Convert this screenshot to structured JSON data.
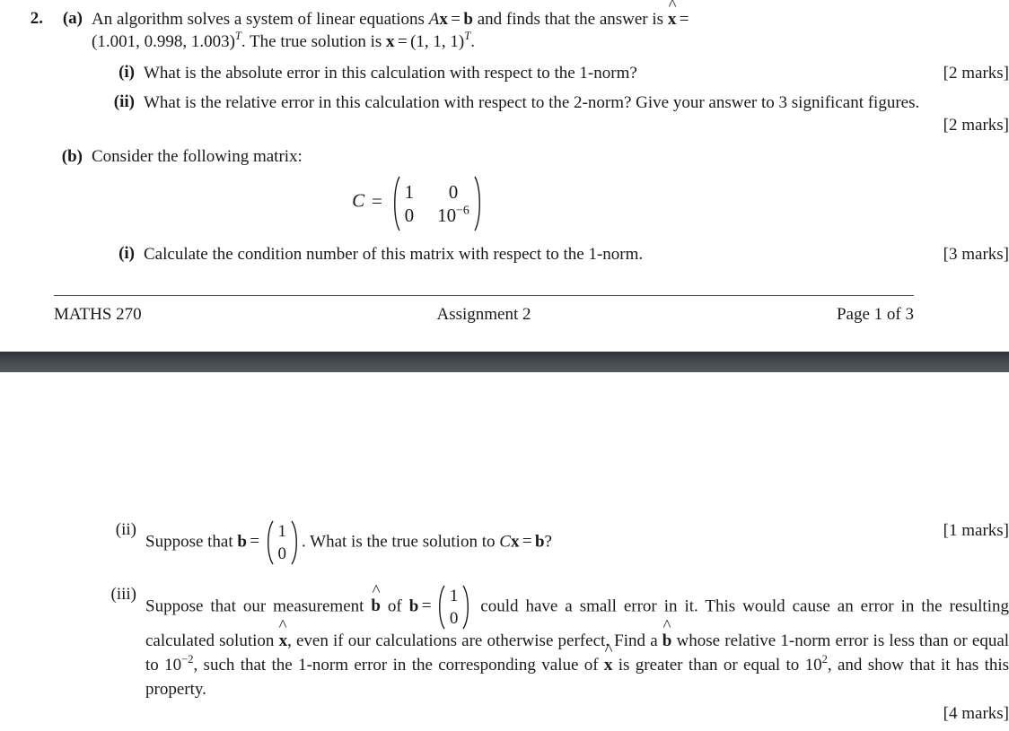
{
  "document": {
    "question_number": "2.",
    "parts": {
      "a": {
        "marker": "(a)",
        "text_1": "An algorithm solves a system of linear equations",
        "math_ax_b": "Ax = b",
        "text_2": "and finds that the answer is",
        "math_xhat": "x̂",
        "math_equals": "=",
        "solution_vector": "(1.001, 0.998, 1.003)",
        "solution_transpose": "T",
        "text_3": ". The true solution is",
        "math_x": "x",
        "true_vector": "(1, 1, 1)",
        "true_transpose": "T",
        "text_4": ".",
        "items": [
          {
            "marker": "(i)",
            "text": "What is the absolute error in this calculation with respect to the 1-norm?",
            "marks": "[2 marks]"
          },
          {
            "marker": "(ii)",
            "text": "What is the relative error in this calculation with respect to the 2-norm?  Give your answer to 3 significant figures.",
            "marks": "[2 marks]"
          }
        ]
      },
      "b": {
        "marker": "(b)",
        "intro": "Consider the following matrix:",
        "matrix": {
          "name": "C",
          "equals": "=",
          "rows": [
            [
              "1",
              "0"
            ],
            [
              "0",
              "10⁻⁶"
            ]
          ],
          "entry_11": "1",
          "entry_12": "0",
          "entry_21": "0",
          "entry_22_base": "10",
          "entry_22_exp": "−6"
        },
        "items": [
          {
            "marker": "(i)",
            "text": "Calculate the condition number of this matrix with respect to the 1-norm.",
            "marks": "[3 marks]"
          },
          {
            "marker": "(ii)",
            "text_1": "Suppose that",
            "math_b": "b",
            "equals": "=",
            "vector": [
              "1",
              "0"
            ],
            "text_2": ". What is the true solution to",
            "math_cx_b": "Cx = b?",
            "marks": "[1 marks]"
          },
          {
            "marker": "(iii)",
            "text_1": "Suppose that our measurement",
            "math_bhat": "b̂",
            "text_2": "of",
            "math_b": "b",
            "equals": "=",
            "vector": [
              "1",
              "0"
            ],
            "text_3": "could have a small error in it. This would cause an error in the resulting calculated solution",
            "math_xhat": "x̂",
            "text_4": ", even if our calculations are otherwise perfect. Find a",
            "math_bhat_2": "b̂",
            "text_5": "whose relative 1-norm error is less than or equal to",
            "bound_low_base": "10",
            "bound_low_exp": "−2",
            "text_6": ", such that the 1-norm error in the corresponding value of",
            "math_xhat_2": "x̂",
            "text_7": "is greater than or equal to",
            "bound_high_base": "10",
            "bound_high_exp": "2",
            "text_8": ", and show that it has this property.",
            "marks": "[4 marks]"
          }
        ]
      }
    }
  },
  "footer": {
    "course": "MATHS 270",
    "assignment": "Assignment 2",
    "page": "Page 1 of 3"
  },
  "colors": {
    "text": "#1a1a1a",
    "rule": "#4a4a4a",
    "separator_top": "#2e3238",
    "separator_bottom": "#53585e",
    "background": "#ffffff"
  }
}
